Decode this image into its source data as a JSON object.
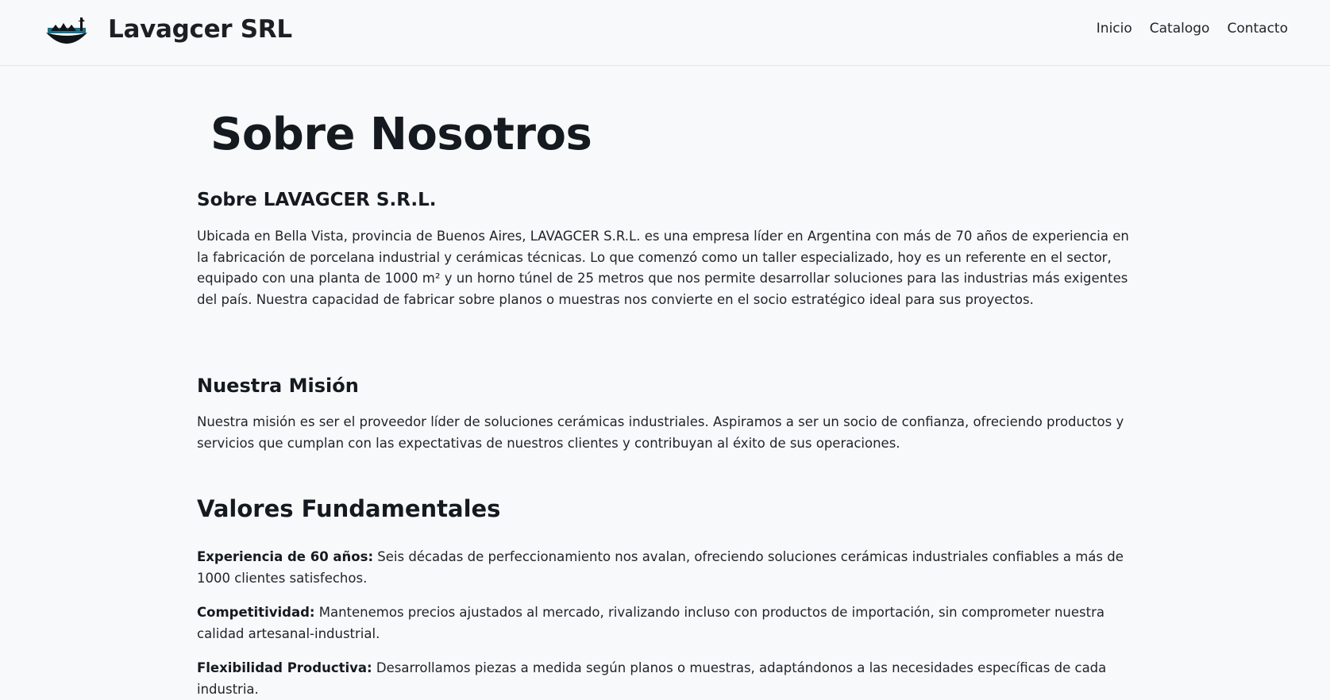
{
  "header": {
    "brand_name": "Lavagcer SRL",
    "logo_icon": "ceramic-insulator-logo",
    "nav": [
      {
        "label": "Inicio"
      },
      {
        "label": "Catalogo"
      },
      {
        "label": "Contacto"
      }
    ]
  },
  "main": {
    "title": "Sobre Nosotros",
    "about": {
      "heading": "Sobre LAVAGCER S.R.L.",
      "text": "Ubicada en Bella Vista, provincia de Buenos Aires, LAVAGCER S.R.L. es una empresa líder en Argentina con más de 70 años de experiencia en la fabricación de porcelana industrial y cerámicas técnicas. Lo que comenzó como un taller especializado, hoy es un referente en el sector, equipado con una planta de 1000 m² y un horno túnel de 25 metros que nos permite desarrollar soluciones para las industrias más exigentes del país. Nuestra capacidad de fabricar sobre planos o muestras nos convierte en el socio estratégico ideal para sus proyectos."
    },
    "mission": {
      "heading": "Nuestra Misión",
      "text": "Nuestra misión es ser el proveedor líder de soluciones cerámicas industriales. Aspiramos a ser un socio de confianza, ofreciendo productos y servicios que cumplan con las expectativas de nuestros clientes y contribuyan al éxito de sus operaciones."
    },
    "values": {
      "heading": "Valores Fundamentales",
      "items": [
        {
          "label": "Experiencia de 60 años:",
          "text": " Seis décadas de perfeccionamiento nos avalan, ofreciendo soluciones cerámicas industriales confiables a más de 1000 clientes satisfechos."
        },
        {
          "label": "Competitividad:",
          "text": " Mantenemos precios ajustados al mercado, rivalizando incluso con productos de importación, sin comprometer nuestra calidad artesanal-industrial."
        },
        {
          "label": "Flexibilidad Productiva:",
          "text": " Desarrollamos piezas a medida según planos o muestras, adaptándonos a las necesidades específicas de cada industria."
        }
      ]
    }
  },
  "colors": {
    "background": "#f8f9fa",
    "heading": "#151a20",
    "text": "#212529",
    "logo_accent": "#1f6e86"
  }
}
